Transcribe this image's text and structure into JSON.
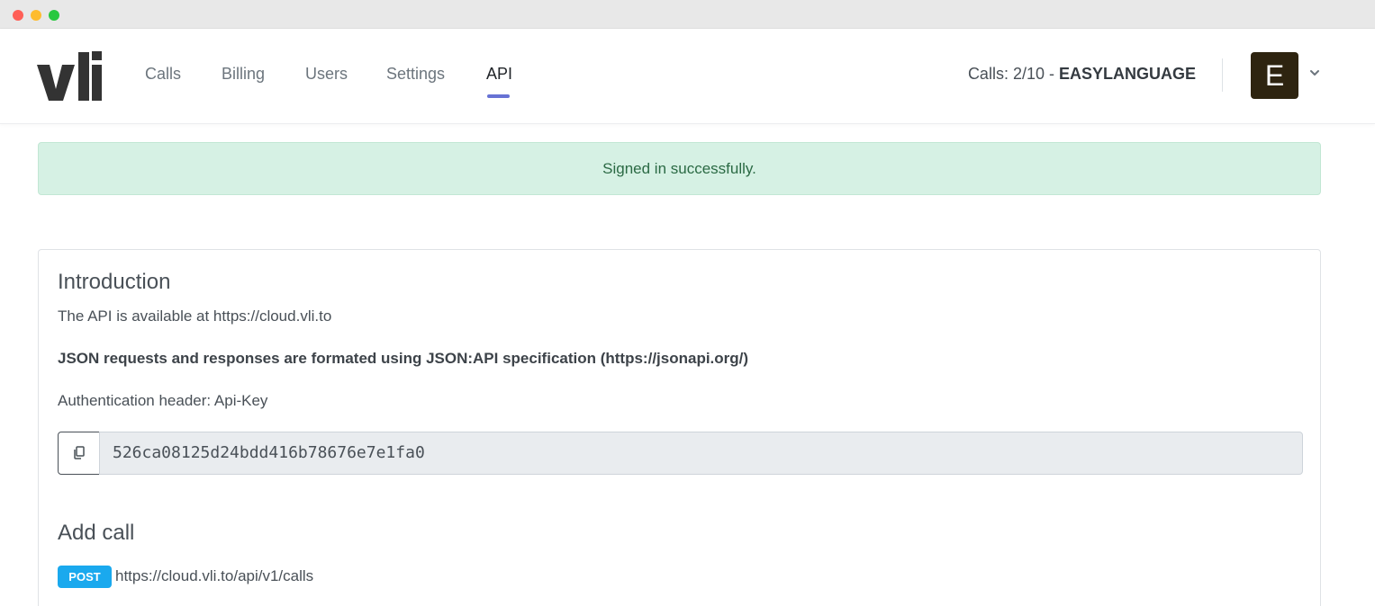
{
  "nav": {
    "items": [
      {
        "label": "Calls"
      },
      {
        "label": "Billing"
      },
      {
        "label": "Users"
      },
      {
        "label": "Settings"
      },
      {
        "label": "API",
        "active": true
      }
    ],
    "calls_prefix": "Calls: 2/10 - ",
    "account_name": "EASYLANGUAGE",
    "avatar_letter": "E",
    "accent_color": "#6772d4"
  },
  "alert": {
    "message": "Signed in successfully."
  },
  "intro": {
    "title": "Introduction",
    "availability": "The API is available at https://cloud.vli.to",
    "json_note": "JSON requests and responses are formated using JSON:API specification (https://jsonapi.org/)",
    "auth_header": "Authentication header: Api-Key",
    "api_key": "526ca08125d24bdd416b78676e7e1fa0"
  },
  "add_call": {
    "title": "Add call",
    "method": "POST",
    "url": "https://cloud.vli.to/api/v1/calls"
  }
}
